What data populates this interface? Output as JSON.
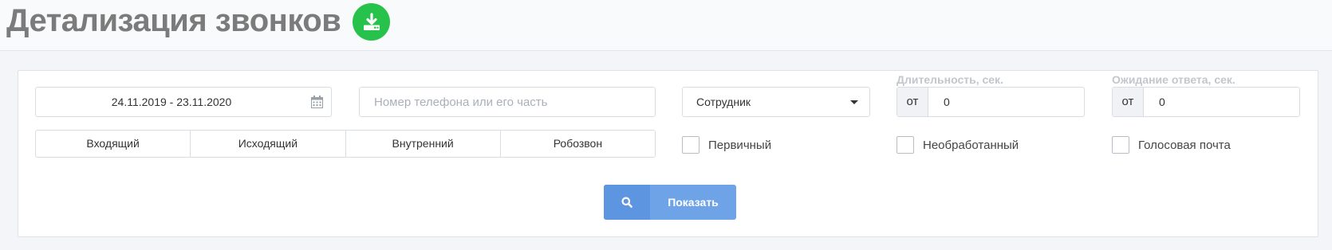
{
  "header": {
    "title": "Детализация звонков",
    "download_icon": "download-icon",
    "download_color": "#27c24c"
  },
  "filters": {
    "date_range": "24.11.2019 - 23.11.2020",
    "calendar_icon": "calendar-icon",
    "phone_placeholder": "Номер телефона или его часть",
    "phone_value": "",
    "employee_selected": "Сотрудник",
    "duration": {
      "label": "Длительность, сек.",
      "from_label": "от",
      "from_value": "0"
    },
    "wait": {
      "label": "Ожидание ответа, сек.",
      "from_label": "от",
      "from_value": "0"
    },
    "call_types": [
      "Входящий",
      "Исходящий",
      "Внутренний",
      "Робозвон"
    ],
    "checkboxes": {
      "primary": "Первичный",
      "unprocessed": "Необработанный",
      "voicemail": "Голосовая почта"
    }
  },
  "actions": {
    "show_label": "Показать",
    "show_icon": "search-icon",
    "show_color": "#6ea3e8"
  }
}
